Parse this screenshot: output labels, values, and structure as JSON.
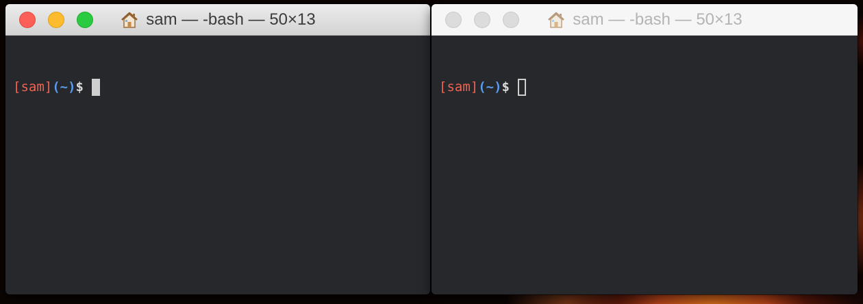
{
  "colors": {
    "terminal_background": "#26282c",
    "prompt_user": "#ef6453",
    "prompt_cwd": "#5a9bef",
    "prompt_sign": "#d8d8d8",
    "close_light": "#fc5f57",
    "minimize_light": "#fdbb2e",
    "zoom_light": "#2aca41"
  },
  "windows": [
    {
      "title": "sam — -bash — 50×13",
      "title_icon": "house-icon",
      "active": true,
      "prompt": {
        "user": "[sam]",
        "cwd": "(~)",
        "sign": "$"
      },
      "cursor": "block-solid"
    },
    {
      "title": "sam — -bash — 50×13",
      "title_icon": "house-icon",
      "active": false,
      "prompt": {
        "user": "[sam]",
        "cwd": "(~)",
        "sign": "$"
      },
      "cursor": "block-hollow"
    }
  ]
}
